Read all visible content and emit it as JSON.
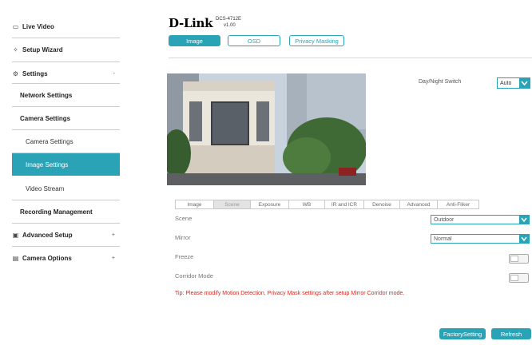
{
  "sidebar": {
    "items": [
      {
        "label": "Live Video",
        "icon": "monitor-icon"
      },
      {
        "label": "Setup Wizard",
        "icon": "wand-icon"
      },
      {
        "label": "Settings",
        "icon": "gear-icon",
        "arrow": "-"
      },
      {
        "label": "Network Settings"
      },
      {
        "label": "Camera Settings"
      },
      {
        "label": "Camera Settings"
      },
      {
        "label": "Image Settings"
      },
      {
        "label": "Video Stream"
      },
      {
        "label": "Recording Management"
      },
      {
        "label": "Advanced Setup",
        "icon": "advanced-setup-icon",
        "arrow": "+"
      },
      {
        "label": "Camera Options",
        "icon": "camera-options-icon",
        "arrow": "+"
      }
    ]
  },
  "header": {
    "logo": "D-Link",
    "model": "DCS-4712E",
    "version": "v1.00"
  },
  "top_tabs": [
    "Image",
    "OSD",
    "Privacy Masking"
  ],
  "day_night": {
    "label": "Day/Night Switch",
    "value": "Auto"
  },
  "sub_tabs": [
    "Image",
    "Scene",
    "Exposure",
    "WB",
    "IR and ICR",
    "Denoise",
    "Advanced",
    "Anti-Fliker"
  ],
  "fields": {
    "scene": {
      "label": "Scene",
      "value": "Outdoor"
    },
    "mirror": {
      "label": "Mirror",
      "value": "Normal"
    },
    "freeze": {
      "label": "Freeze"
    },
    "corridor": {
      "label": "Corridor Mode"
    }
  },
  "tip": "Tip: Please modify Motion Detection, Privacy Mask settings after setup Mirror Corridor mode.",
  "buttons": {
    "factory": "FactorySetting",
    "refresh": "Refresh"
  },
  "colors": {
    "accent": "#2aa3b7",
    "tip": "#d9261c"
  }
}
